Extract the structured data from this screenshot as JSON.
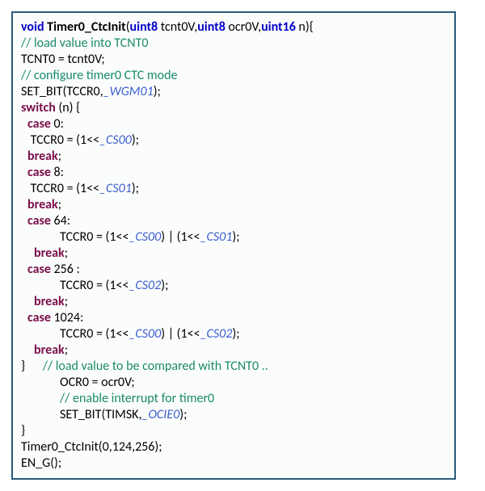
{
  "code": {
    "sig_void": "void",
    "sig_fn": "Timer0_CtcInit",
    "sig_args_open": "(",
    "sig_t1": "uint8",
    "sig_a1": " tcnt0V,",
    "sig_t2": "uint8",
    "sig_a2": " ocr0V,",
    "sig_t3": "uint16",
    "sig_a3": " n){",
    "cm1": "// load value into TCNT0",
    "l3": "TCNT0 = tcnt0V;",
    "cm2": "// configure timer0 CTC mode",
    "l5a": "SET_BIT(TCCR0,",
    "l5b": "_WGM01",
    "l5c": ");",
    "sw": "switch",
    "sw2": " (n) {",
    "case_kw": "case",
    "c0": " 0:",
    "l8a": " TCCR0 = (1<<",
    "cs00": "_CS00",
    "cl_paren_semi": ");",
    "break_kw": "break",
    "semi": ";",
    "c8": " 8:",
    "l11a": " TCCR0 = (1<<",
    "cs01": "_CS01",
    "c64": " 64:",
    "l14a": "TCCR0 = (1<<",
    "l14mid": ") | (1<<",
    "c256": " 256 :",
    "l17a": "TCCR0 = (1<<",
    "cs02": "_CS02",
    "c1024": " 1024:",
    "l20a": "TCCR0 = (1<<",
    "close_brace": "}",
    "cm3": "// load value to be compared with TCNT0 ..",
    "l23": "OCR0 = ocr0V;",
    "cm4": "// enable interrupt for timer0",
    "l25a": "SET_BIT(TIMSK,",
    "ocie0": "_OCIE0",
    "call": "Timer0_CtcInit(0,124,256);",
    "call2": "EN_G();",
    "sp": " "
  }
}
